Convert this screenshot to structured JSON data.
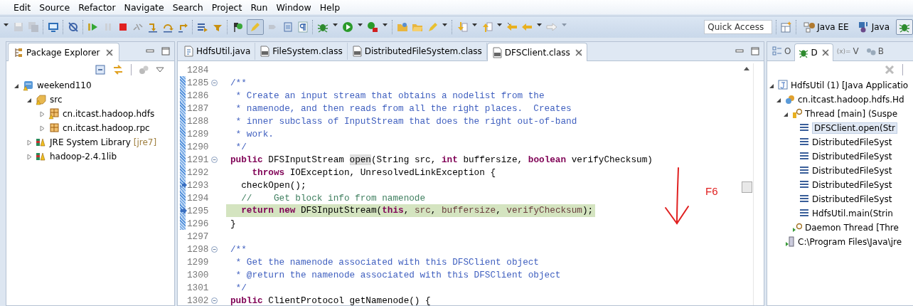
{
  "menu": [
    "Edit",
    "Source",
    "Refactor",
    "Navigate",
    "Search",
    "Project",
    "Run",
    "Window",
    "Help"
  ],
  "quick_access": {
    "placeholder": "Quick Access"
  },
  "perspectives": [
    {
      "label": "Java EE",
      "kind": "javaee",
      "selected": false
    },
    {
      "label": "Java",
      "kind": "java",
      "selected": false
    },
    {
      "kind": "debug",
      "selected": true
    }
  ],
  "package_explorer": {
    "title": "Package Explorer",
    "tree": [
      {
        "label": "weekend110",
        "kind": "project",
        "expanded": true,
        "children": [
          {
            "label": "src",
            "kind": "source",
            "expanded": true,
            "children": [
              {
                "label": "cn.itcast.hadoop.hdfs",
                "kind": "package-warn",
                "expanded": false
              },
              {
                "label": "cn.itcast.hadoop.rpc",
                "kind": "package",
                "expanded": false
              }
            ]
          },
          {
            "label": "JRE System Library",
            "decoration": "[jre7]",
            "kind": "library",
            "expanded": false
          },
          {
            "label": "hadoop-2.4.1lib",
            "kind": "library",
            "expanded": false
          }
        ]
      }
    ]
  },
  "editor": {
    "tabs": [
      {
        "label": "HdfsUtil.java",
        "kind": "java",
        "selected": false
      },
      {
        "label": "FileSystem.class",
        "kind": "class",
        "selected": false
      },
      {
        "label": "DistributedFileSystem.class",
        "kind": "class",
        "selected": false
      },
      {
        "label": "DFSClient.class",
        "kind": "class",
        "selected": true
      }
    ],
    "lines": [
      {
        "number": "1284"
      },
      {
        "number": "1285",
        "fold": true,
        "range": true,
        "segs": [
          {
            "kind": "doc",
            "t": "/**"
          }
        ]
      },
      {
        "number": "1286",
        "range": true,
        "segs": [
          {
            "kind": "doc",
            "t": " * Create an input stream that obtains a nodelist from the"
          }
        ]
      },
      {
        "number": "1287",
        "range": true,
        "segs": [
          {
            "kind": "doc",
            "t": " * namenode, and then reads from all the right places.  Creates"
          }
        ]
      },
      {
        "number": "1288",
        "range": true,
        "segs": [
          {
            "kind": "doc",
            "t": " * inner subclass of InputStream that does the right out-of-band"
          }
        ]
      },
      {
        "number": "1289",
        "range": true,
        "segs": [
          {
            "kind": "doc",
            "t": " * work."
          }
        ]
      },
      {
        "number": "1290",
        "range": true,
        "segs": [
          {
            "kind": "doc",
            "t": " */"
          }
        ]
      },
      {
        "number": "1291",
        "fold": true,
        "range": true,
        "segs": [
          {
            "kind": "kw",
            "t": "public"
          },
          {
            "kind": "plain",
            "t": " DFSInputStream "
          },
          {
            "kind": "mark",
            "t": "open"
          },
          {
            "kind": "plain",
            "t": "(String src, "
          },
          {
            "kind": "kw",
            "t": "int"
          },
          {
            "kind": "plain",
            "t": " buffersize, "
          },
          {
            "kind": "kw",
            "t": "boolean"
          },
          {
            "kind": "plain",
            "t": " verifyChecksum)"
          }
        ]
      },
      {
        "number": "1292",
        "range": true,
        "segs": [
          {
            "kind": "kw",
            "t": "    throws"
          },
          {
            "kind": "plain",
            "t": " IOException, UnresolvedLinkException {"
          }
        ]
      },
      {
        "number": "1293",
        "range": true,
        "stack_frame": true,
        "segs": [
          {
            "kind": "plain",
            "t": "  checkOpen();"
          }
        ]
      },
      {
        "number": "1294",
        "range": true,
        "segs": [
          {
            "kind": "comment",
            "t": "  //    Get block info from namenode"
          }
        ]
      },
      {
        "number": "1295",
        "range": true,
        "stack_frame": true,
        "instruction_pointer": true,
        "current": true,
        "segs": [
          {
            "kind": "kw",
            "t": "  return new"
          },
          {
            "kind": "plain",
            "t": " DFSInputStream("
          },
          {
            "kind": "kw",
            "t": "this"
          },
          {
            "kind": "plain",
            "t": ", "
          },
          {
            "kind": "param",
            "t": "src"
          },
          {
            "kind": "plain",
            "t": ", "
          },
          {
            "kind": "param",
            "t": "buffersize"
          },
          {
            "kind": "plain",
            "t": ", "
          },
          {
            "kind": "param",
            "t": "verifyChecksum"
          },
          {
            "kind": "plain",
            "t": ");"
          }
        ]
      },
      {
        "number": "1296",
        "range": true,
        "segs": [
          {
            "kind": "plain",
            "t": "}"
          }
        ]
      },
      {
        "number": "1297"
      },
      {
        "number": "1298",
        "fold": true,
        "segs": [
          {
            "kind": "doc",
            "t": "/**"
          }
        ]
      },
      {
        "number": "1299",
        "segs": [
          {
            "kind": "doc",
            "t": " * Get the namenode associated with this DFSClient object"
          }
        ]
      },
      {
        "number": "1300",
        "segs": [
          {
            "kind": "doc",
            "t": " * @return the namenode associated with this DFSClient object"
          }
        ]
      },
      {
        "number": "1301",
        "segs": [
          {
            "kind": "doc",
            "t": " */"
          }
        ]
      },
      {
        "number": "1302",
        "fold": true,
        "segs": [
          {
            "kind": "kw",
            "t": "public"
          },
          {
            "kind": "plain",
            "t": " ClientProtocol getNamenode() {"
          }
        ]
      }
    ]
  },
  "annotation": {
    "text": "F6"
  },
  "debug": {
    "tabs": [
      {
        "label": "O",
        "kind": "outline",
        "selected": false
      },
      {
        "label": "D",
        "kind": "debug",
        "selected": true
      },
      {
        "label": "V",
        "icon_text": "(x)=",
        "kind": "variables",
        "selected": false
      },
      {
        "label": "B",
        "kind": "breakpoints",
        "selected": false
      }
    ],
    "tree": [
      {
        "label": "HdfsUtil (1) [Java Applicatio",
        "kind": "launch",
        "expanded": true,
        "children": [
          {
            "label": "cn.itcast.hadoop.hdfs.Hd",
            "kind": "vm",
            "expanded": true,
            "children": [
              {
                "label": "Thread [main] (Suspe",
                "kind": "thread",
                "expanded": true,
                "children": [
                  {
                    "label": "DFSClient.open(Str",
                    "kind": "frame",
                    "selected": true
                  },
                  {
                    "label": "DistributedFileSyst",
                    "kind": "frame",
                    "selected": false
                  },
                  {
                    "label": "DistributedFileSyst",
                    "kind": "frame",
                    "selected": false
                  },
                  {
                    "label": "DistributedFileSyst",
                    "kind": "frame",
                    "selected": false
                  },
                  {
                    "label": "DistributedFileSyst",
                    "kind": "frame",
                    "selected": false
                  },
                  {
                    "label": "DistributedFileSyst",
                    "kind": "frame",
                    "selected": false
                  },
                  {
                    "label": "HdfsUtil.main(Strin",
                    "kind": "frame",
                    "selected": false
                  }
                ]
              },
              {
                "label": "Daemon Thread [Thre",
                "kind": "daemon"
              }
            ]
          },
          {
            "label": "C:\\Program Files\\Java\\jre",
            "kind": "process"
          }
        ]
      }
    ]
  }
}
